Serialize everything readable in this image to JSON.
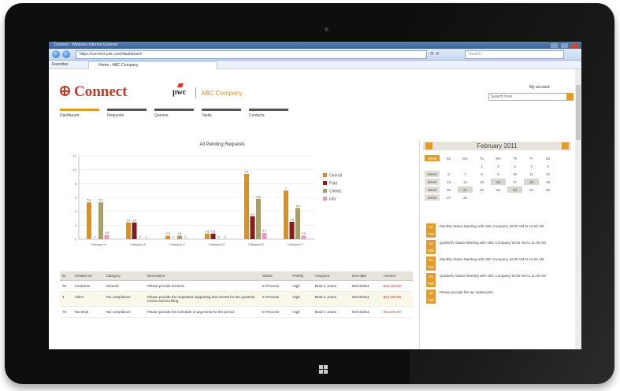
{
  "browser": {
    "title": "Connect - Windows Internet Explorer",
    "url": "https://connect.pwc.com/dashboard",
    "search_placeholder": "Search",
    "favorites_label": "Favorites",
    "tab_label": "Home - ABC Company"
  },
  "header": {
    "brand": "Connect",
    "pwc": "pwc",
    "company": "ABC Company",
    "user_menu": "My account",
    "search_placeholder": "Search here"
  },
  "tabs": [
    {
      "label": "Dashboard",
      "active": true
    },
    {
      "label": "Requests",
      "active": false
    },
    {
      "label": "Queries",
      "active": false
    },
    {
      "label": "Tasks",
      "active": false
    },
    {
      "label": "Contacts",
      "active": false
    }
  ],
  "chart_data": {
    "type": "bar",
    "title": "All Pending Requests",
    "categories": [
      "Category A",
      "Category B",
      "Category C",
      "Category D",
      "Category E",
      "Category F"
    ],
    "ylim": [
      0,
      12
    ],
    "yticks": [
      0,
      2,
      4,
      6,
      8,
      10,
      12
    ],
    "series": [
      {
        "name": "Overall",
        "color": "#d4922a",
        "values": [
          5.3,
          2.4,
          0.5,
          0.8,
          9.4,
          7.0
        ]
      },
      {
        "name": "Paid",
        "color": "#8b1a1a",
        "values": [
          0,
          2.4,
          0,
          0.8,
          3.3,
          2.5
        ]
      },
      {
        "name": "Clients",
        "color": "#a8a060",
        "values": [
          5.3,
          0,
          0.5,
          0,
          5.8,
          4.5
        ]
      },
      {
        "name": "Info",
        "color": "#e59abf",
        "values": [
          0.6,
          0,
          0,
          0,
          0.9,
          0.5
        ]
      }
    ],
    "legend": "right",
    "grid": true
  },
  "table": {
    "headers": [
      "ID",
      "Created on",
      "Category",
      "Description",
      "Status",
      "Priority",
      "Assigned",
      "Due date",
      "Amount"
    ],
    "rows": [
      {
        "id": "78",
        "created": "Contracts",
        "category": "General",
        "description": "Please provide invoices",
        "status": "In Process",
        "priority": "High",
        "assigned": "Brad C Jones",
        "due": "02/14/2011",
        "amount": "$19,520.00",
        "alt": false
      },
      {
        "id": "4",
        "created": "Client",
        "category": "Tax compliance",
        "description": "Please provide the requested supporting documents for the quarterly review and tax filing",
        "status": "In Process",
        "priority": "High",
        "assigned": "Brad C Jones",
        "due": "02/14/2011",
        "amount": "$12,330.00",
        "alt": true
      },
      {
        "id": "78",
        "created": "Tax Dept",
        "category": "Tax compliance",
        "description": "Please provide the schedule of payments for the period",
        "status": "In Process",
        "priority": "High",
        "assigned": "Brad C Jones",
        "due": "02/14/2011",
        "amount": "$11,520.00",
        "alt": false
      }
    ]
  },
  "calendar": {
    "month": "February 2011",
    "weekdays": [
      "Week",
      "Su",
      "Mo",
      "Tu",
      "We",
      "Th",
      "Fr",
      "Sa"
    ],
    "weeks": [
      [
        "",
        "",
        "",
        "1",
        "2",
        "3",
        "4",
        "5"
      ],
      [
        "Week",
        "6",
        "7",
        "8",
        "9",
        "10",
        "11",
        "12"
      ],
      [
        "Week",
        "13",
        "14",
        "15",
        "16",
        "17",
        "18",
        "19"
      ],
      [
        "Week",
        "20",
        "21",
        "22",
        "23",
        "24",
        "25",
        "26"
      ],
      [
        "Week",
        "27",
        "28",
        "",
        "",
        "",
        "",
        ""
      ]
    ]
  },
  "events": [
    {
      "day": "16 Feb",
      "text": "Monthly Status Meeting with ABC Company  10:00 AM to 11:00 AM"
    },
    {
      "day": "18 Feb",
      "text": "Quarterly Status Meeting with ABC Company  10:00 AM to 11:00 AM"
    },
    {
      "day": "21 Feb",
      "text": "Monthly Status Meeting with ABC Company  10:00 AM to 11:00 AM"
    },
    {
      "day": "24 Feb",
      "text": "Quarterly Status Meeting with ABC Company  10:00 AM to 11:00 AM"
    },
    {
      "day": "28 Feb",
      "text": "Please provide the tax statements"
    }
  ]
}
